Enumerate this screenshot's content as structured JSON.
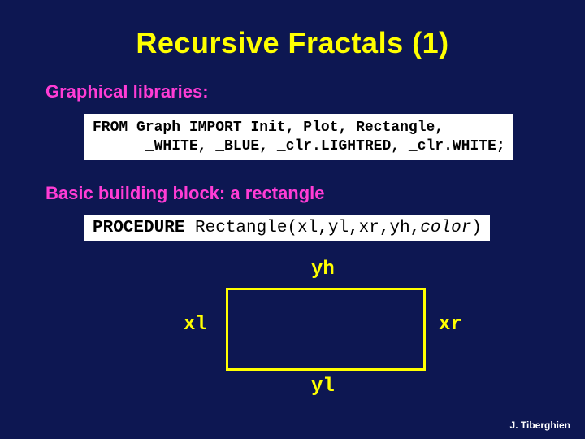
{
  "title": "Recursive Fractals (1)",
  "section1": "Graphical libraries:",
  "code1_line1a": "FROM",
  "code1_line1b": " Graph ",
  "code1_line1c": "IMPORT",
  "code1_line1d": " Init, Plot, Rectangle,",
  "code1_line2": "      _WHITE, _BLUE, _clr.LIGHTRED, _clr.WHITE;",
  "section2": "Basic building block: a rectangle",
  "code2_a": "PROCEDURE",
  "code2_b": " Rectangle(xl,yl,xr,yh,",
  "code2_c": "color",
  "code2_d": ")",
  "diagram": {
    "yh": "yh",
    "yl": "yl",
    "xl": "xl",
    "xr": "xr"
  },
  "footer": "J. Tiberghien"
}
